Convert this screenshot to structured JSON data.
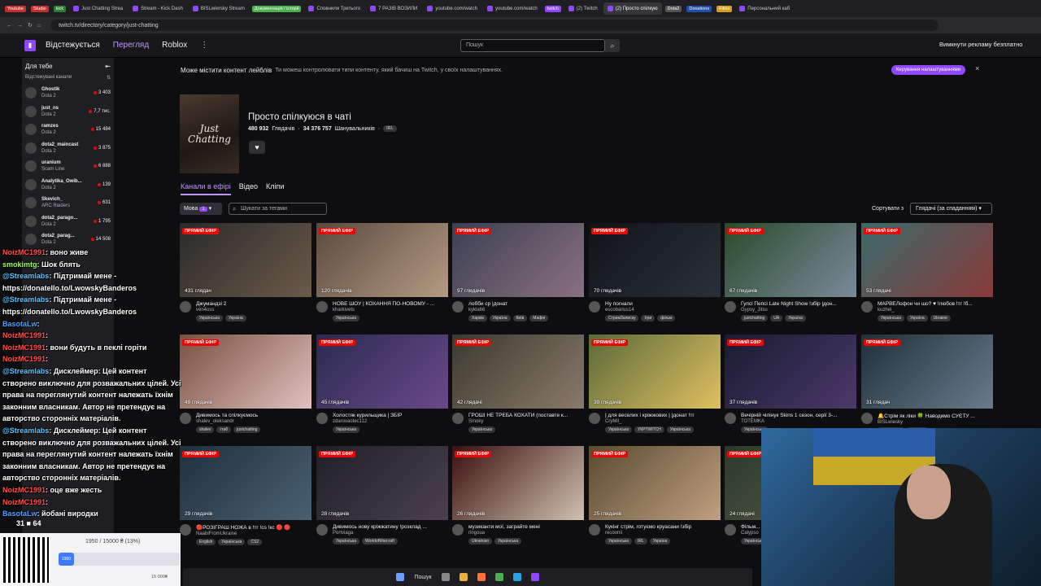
{
  "browser": {
    "tabs": [
      {
        "label": "Youtube",
        "chip": true,
        "color": "#c4302b"
      },
      {
        "label": "Studio",
        "chip": true,
        "color": "#c4302b"
      },
      {
        "label": "kick",
        "chip": true,
        "color": "#2e7d32"
      },
      {
        "label": "Just Chatting Strea"
      },
      {
        "label": "Stream - Kick Dash"
      },
      {
        "label": "BISLwiersky Stream"
      },
      {
        "label": "Документація / історії",
        "chip": true,
        "color": "#4caf50"
      },
      {
        "label": "Сповнили Третього"
      },
      {
        "label": "7 РАЗІВ ВОЗИЛИ"
      },
      {
        "label": "youtube.com/watch"
      },
      {
        "label": "youtube.com/watch"
      },
      {
        "label": "twitch",
        "chip": true,
        "color": "#9147ff"
      },
      {
        "label": "(2) Twitch"
      },
      {
        "label": "(2) Просто спілкую",
        "active": true
      },
      {
        "label": "Dota2",
        "chip": true,
        "color": "#555"
      },
      {
        "label": "Donations",
        "chip": true,
        "color": "#1e4fa8"
      },
      {
        "label": "Films",
        "chip": true,
        "color": "#d4a017"
      },
      {
        "label": "Персональний каб"
      }
    ],
    "url": "twitch.tv/directory/category/just-chatting"
  },
  "nav": {
    "following": "Відстежується",
    "browse": "Перегляд",
    "roblox": "Roblox",
    "more": "⋮",
    "search_placeholder": "Пошук",
    "adfree": "Вимкнути рекламу безплатно"
  },
  "sidebar": {
    "for_you": "Для тебе",
    "followed": "Відстежувані канали",
    "channels": [
      {
        "name": "Ghostik",
        "game": "Dota 2",
        "viewers": "3 403"
      },
      {
        "name": "just_ns",
        "game": "Dota 2",
        "viewers": "7,7 тис."
      },
      {
        "name": "ramzes",
        "game": "Dota 2",
        "viewers": "15 484"
      },
      {
        "name": "dota2_maincast",
        "game": "Dota 2",
        "viewers": "3 875"
      },
      {
        "name": "uranium",
        "game": "Scam Line",
        "viewers": "6 888"
      },
      {
        "name": "Analytika_Owib...",
        "game": "Dota 2",
        "viewers": "139"
      },
      {
        "name": "Skevich_",
        "game": "ARC Raiders",
        "viewers": "631"
      },
      {
        "name": "dota2_parago...",
        "game": "Dota 2",
        "viewers": "1 795"
      },
      {
        "name": "dota2_parag...",
        "game": "Dota 2",
        "viewers": "14 508"
      }
    ]
  },
  "banner": {
    "title": "Може містити контент лейблів",
    "text": "Ти можеш контролювати типи контенту, який бачиш на Twitch, у своїх налаштуваннях.",
    "button": "Керування налаштуваннями",
    "close": "×"
  },
  "category": {
    "boxart": "Just Chatting",
    "title": "Просто спілкуюся в чаті",
    "viewers": "480 932",
    "viewers_label": "Глядачів",
    "followers": "34 376 757",
    "followers_label": "Шанувальників",
    "tag": "IRL",
    "heart": "♥"
  },
  "subtabs": {
    "live": "Канали в ефірі",
    "video": "Відео",
    "clips": "Кліпи"
  },
  "filters": {
    "lang": "Мова",
    "lang_count": "1",
    "tag_placeholder": "Шукати за тегами",
    "sort_label": "Сортувати з",
    "sort_value": "Глядачі (за спаданням)"
  },
  "live_label": "ПРЯМИЙ ЕФІР",
  "cards": [
    {
      "viewers": "431 глядач",
      "title": "Джумандзі 2",
      "name": "ven4oss",
      "tags": [
        "Українська",
        "Україна"
      ],
      "c1": "#2a2a2a",
      "c2": "#6b5a4a"
    },
    {
      "viewers": "120 глядачів",
      "title": "НОВЕ ШОУ | КОХАННЯ ПО-НОВОМУ - ...",
      "name": "kharkivets",
      "tags": [
        "Українська"
      ],
      "c1": "#5a4a40",
      "c2": "#b59a82"
    },
    {
      "viewers": "97 глядачів",
      "title": "лобби ср |донат",
      "name": "kykla66",
      "tags": [
        "Харків",
        "Україна",
        "Київ",
        "Мафія"
      ],
      "c1": "#3a4050",
      "c2": "#8a7080"
    },
    {
      "viewers": "70 глядачів",
      "title": "Ну погнали",
      "name": "escobarlus14",
      "tags": [
        "СтримЗаписку",
        "Ігри",
        "фільм"
      ],
      "c1": "#101418",
      "c2": "#2a3038"
    },
    {
      "viewers": "67 глядачів",
      "title": "Гупсі Пепсі Late Night Show !збір |дон...",
      "name": "Gypsy_Jitsu",
      "tags": [
        "justchatting",
        "UA",
        "Україна"
      ],
      "c1": "#2a4a2a",
      "c2": "#7a8a9a"
    },
    {
      "viewers": "53 глядачі",
      "title": "МАРВЕЛофон чи шо? ♥ !любов !тг !б...",
      "name": "kuzhel_",
      "tags": [
        "Українська",
        "Україна",
        "Ukraine"
      ],
      "c1": "#3a6a6a",
      "c2": "#8a3a3a"
    },
    {
      "viewers": "49 глядачів",
      "title": "Дивимось та спілкуємось",
      "name": "shalev_oleksandr",
      "tags": [
        "shalev",
        "гтаб",
        "justchatting"
      ],
      "c1": "#7a5040",
      "c2": "#e0c0c0"
    },
    {
      "viewers": "45 глядачів",
      "title": "Холостяк курильщика | ЗБІР",
      "name": "zdarovaotec112",
      "tags": [
        "Українська"
      ],
      "c1": "#2a2a50",
      "c2": "#6a4a8a"
    },
    {
      "viewers": "42 глядачі",
      "title": "ГРОШІ НЕ ТРЕБА КОХАТИ (поставте к...",
      "name": "Smoky",
      "tags": [
        "Українська"
      ],
      "c1": "#3a3a30",
      "c2": "#8a7a6a"
    },
    {
      "viewers": "39 глядачів",
      "title": "| для веселих і кріжжових | |донат !тг",
      "name": "CryMil_",
      "tags": [
        "Українська",
        "УКРTWITCH",
        "Українська"
      ],
      "c1": "#5a6a3a",
      "c2": "#e0c060"
    },
    {
      "viewers": "37 глядачів",
      "title": "Вечірній чілінук Skins 1 сезон, серії 3-...",
      "name": "TOTEMKA",
      "tags": [
        "Українська"
      ],
      "c1": "#1a1a30",
      "c2": "#4a3a6a"
    },
    {
      "viewers": "31 глядач",
      "title": "🔔Стрім як ліки 🍀 Наводимо СУЄТУ ...",
      "name": "BISLwiesky",
      "tags": [
        "Українська",
        "Україна"
      ],
      "c1": "#20303a",
      "c2": "#6a7a8a"
    },
    {
      "viewers": "29 глядачів",
      "title": "🔴РОЗІГРАШ НОЖА в !тг !cs !кс 🔴 🔴",
      "name": "NaabiFromUkraine",
      "tags": [
        "English",
        "Українська",
        "CS2"
      ],
      "c1": "#203040",
      "c2": "#4a6070"
    },
    {
      "viewers": "28 глядачів",
      "title": "Дивимось нову кріжжатину !розклад ...",
      "name": "Portviaga",
      "tags": [
        "Українська",
        "WorldofWarcraft"
      ],
      "c1": "#202028",
      "c2": "#4a4050"
    },
    {
      "viewers": "26 глядачів",
      "title": "музиканти мої, заграйте мені",
      "name": "ringoua",
      "tags": [
        "Ukrainian",
        "Українська"
      ],
      "c1": "#3a1010",
      "c2": "#d0c0b0"
    },
    {
      "viewers": "25 глядачів",
      "title": "Кукінг стрім, готуємо круасани !збір",
      "name": "recoonii",
      "tags": [
        "Українська",
        "IRL",
        "Україна"
      ],
      "c1": "#5a4a30",
      "c2": "#c0a080"
    },
    {
      "viewers": "24 глядачі",
      "title": "Фільм...",
      "name": "Calypso",
      "tags": [
        "Українська"
      ],
      "c1": "#2a3a2a",
      "c2": "#5a5a4a"
    }
  ],
  "chat": [
    {
      "u": "NoizMC1991",
      "m": "воно живе"
    },
    {
      "u": "smokimtg",
      "m": "Шок блять"
    },
    {
      "u": "@Streamlabs",
      "m": "Підтримай мене -"
    },
    {
      "u": "",
      "m": "https://donatello.to/LwowskyBanderos"
    },
    {
      "u": "@Streamlabs",
      "m": "Підтримай мене -"
    },
    {
      "u": "",
      "m": "https://donatello.to/LwowskyBanderos"
    },
    {
      "u": "BasotaLw",
      "m": ""
    },
    {
      "u": "NoizMC1991",
      "m": ""
    },
    {
      "u": "NoizMC1991",
      "m": "вони будуть в пеклі горіти"
    },
    {
      "u": "NoizMC1991",
      "m": ""
    },
    {
      "u": "@Streamlabs",
      "m": "Дисклеймер: Цей контент"
    },
    {
      "u": "",
      "m": "створено виключно для розважальних цілей. Усі"
    },
    {
      "u": "",
      "m": "права на переглянутий контент належать їхнім"
    },
    {
      "u": "",
      "m": "законним власникам. Автор не претендує на"
    },
    {
      "u": "",
      "m": "авторство сторонніх матеріалів."
    },
    {
      "u": "@Streamlabs",
      "m": "Дисклеймер: Цей контент"
    },
    {
      "u": "",
      "m": "створено виключно для розважальних цілей. Усі"
    },
    {
      "u": "",
      "m": "права на переглянутий контент належать їхнім"
    },
    {
      "u": "",
      "m": "законним власникам. Автор не претендує на"
    },
    {
      "u": "",
      "m": "авторство сторонніх матеріалів."
    },
    {
      "u": "NoizMC1991",
      "m": "оце вже жесть"
    },
    {
      "u": "NoizMC1991",
      "m": ""
    },
    {
      "u": "BasotaLw",
      "m": "йобані виродки"
    }
  ],
  "donation_goal": {
    "text": "1950 / 15000 ₴ (13%)",
    "progress": 0.13,
    "fill_label": "1950",
    "end": "15 000₴",
    "stats": "31 ■ 64"
  },
  "taskbar": {
    "search": "Пошук"
  }
}
